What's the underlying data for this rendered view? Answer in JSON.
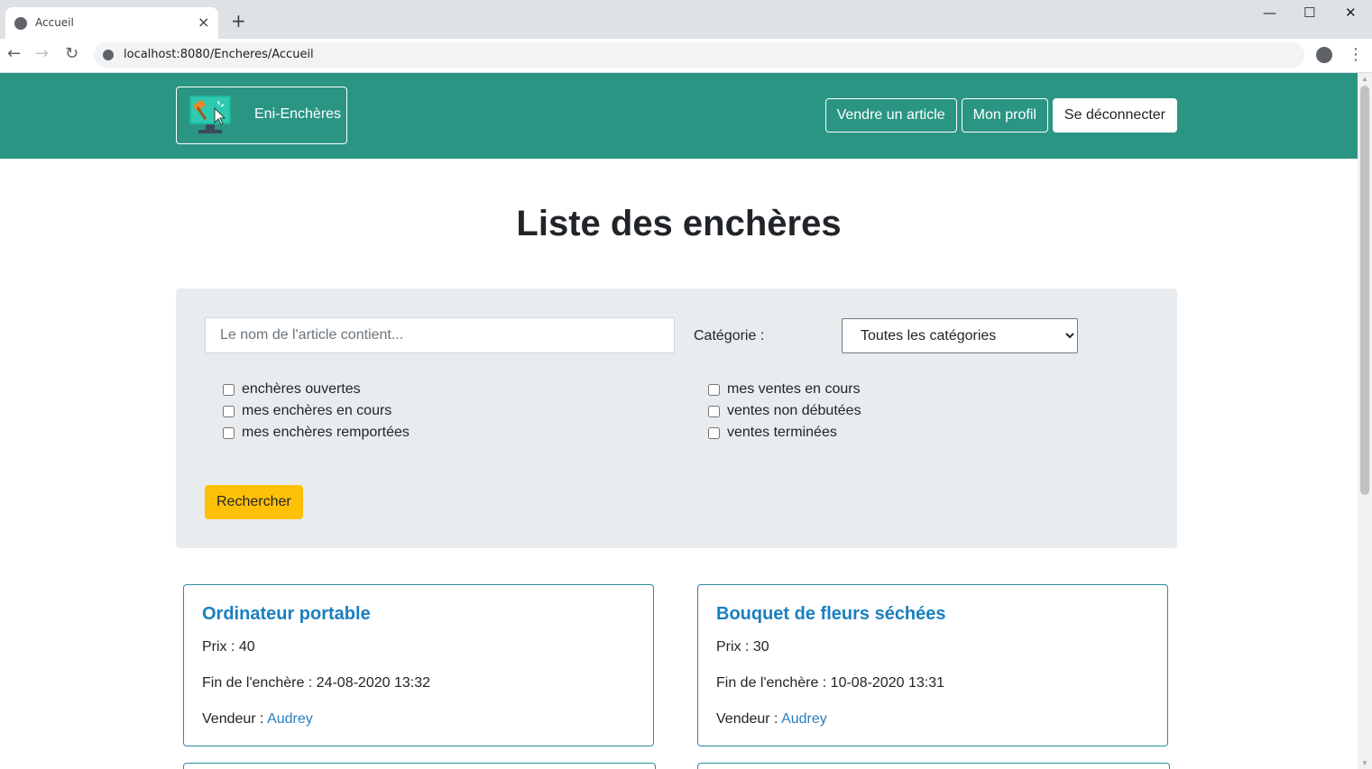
{
  "browser": {
    "tab_title": "Accueil",
    "url": "localhost:8080/Encheres/Accueil"
  },
  "site": {
    "brand": "Eni-Enchères",
    "nav": {
      "sell": "Vendre un article",
      "profile": "Mon profil",
      "logout": "Se déconnecter"
    }
  },
  "page": {
    "title": "Liste des enchères"
  },
  "filters": {
    "search_placeholder": "Le nom de l'article contient...",
    "category_label": "Catégorie :",
    "category_selected": "Toutes les catégories",
    "left_checks": [
      "enchères ouvertes",
      "mes enchères en cours",
      "mes enchères remportées"
    ],
    "right_checks": [
      "mes ventes en cours",
      "ventes non débutées",
      "ventes terminées"
    ],
    "search_button": "Rechercher"
  },
  "cards": [
    {
      "title": "Ordinateur portable",
      "price": "Prix : 40",
      "end": "Fin de l'enchère : 24-08-2020 13:32",
      "seller_label": "Vendeur : ",
      "seller": "Audrey"
    },
    {
      "title": "Bouquet de fleurs séchées",
      "price": "Prix : 30",
      "end": "Fin de l'enchère : 10-08-2020 13:31",
      "seller_label": "Vendeur : ",
      "seller": "Audrey"
    }
  ],
  "icons": {
    "tab_close": "×",
    "new_tab": "+",
    "back": "←",
    "forward": "→",
    "reload": "↻",
    "minimize": "—",
    "maximize": "☐",
    "close": "✕",
    "menu": "⋮",
    "select_arrow": "chevron-down"
  },
  "colors": {
    "navbar": "#2a9583",
    "panel": "#e9ecef",
    "search_button": "#ffc107",
    "card_border": "#2a8ca0",
    "link": "#1a7fc0"
  }
}
